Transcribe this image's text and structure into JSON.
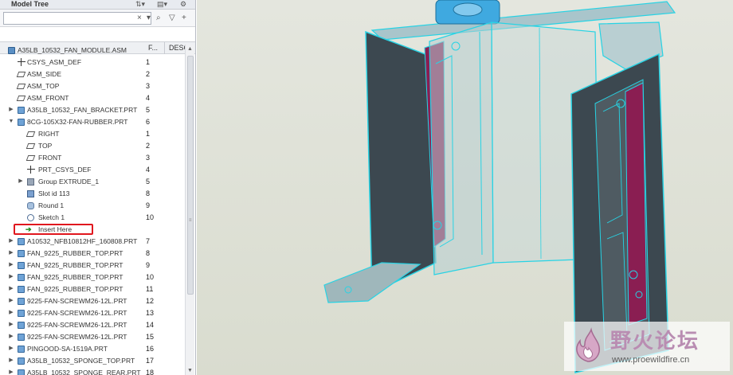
{
  "tree_panel": {
    "title": "Model Tree",
    "search": {
      "value": "",
      "placeholder": ""
    },
    "columns": [
      "F...",
      "DESCF"
    ],
    "rows": [
      {
        "label": "A35LB_10532_FAN_MODULE.ASM",
        "num": "",
        "icon": "assembly-icon",
        "level": 0,
        "expander": ""
      },
      {
        "label": "CSYS_ASM_DEF",
        "num": "1",
        "icon": "csys-icon",
        "level": 1,
        "expander": ""
      },
      {
        "label": "ASM_SIDE",
        "num": "2",
        "icon": "datum-plane-icon",
        "level": 1,
        "expander": ""
      },
      {
        "label": "ASM_TOP",
        "num": "3",
        "icon": "datum-plane-icon",
        "level": 1,
        "expander": ""
      },
      {
        "label": "ASM_FRONT",
        "num": "4",
        "icon": "datum-plane-icon",
        "level": 1,
        "expander": ""
      },
      {
        "label": "A35LB_10532_FAN_BRACKET.PRT",
        "num": "5",
        "icon": "part-icon",
        "level": 1,
        "expander": "▶"
      },
      {
        "label": "8CG-105X32-FAN-RUBBER.PRT",
        "num": "6",
        "icon": "part-icon",
        "level": 1,
        "expander": "▼"
      },
      {
        "label": "RIGHT",
        "num": "1",
        "icon": "datum-plane-icon",
        "level": 2,
        "expander": ""
      },
      {
        "label": "TOP",
        "num": "2",
        "icon": "datum-plane-icon",
        "level": 2,
        "expander": ""
      },
      {
        "label": "FRONT",
        "num": "3",
        "icon": "datum-plane-icon",
        "level": 2,
        "expander": ""
      },
      {
        "label": "PRT_CSYS_DEF",
        "num": "4",
        "icon": "csys-icon",
        "level": 2,
        "expander": ""
      },
      {
        "label": "Group EXTRUDE_1",
        "num": "5",
        "icon": "group-icon",
        "level": 2,
        "expander": "▶"
      },
      {
        "label": "Slot id 113",
        "num": "8",
        "icon": "slot-icon",
        "level": 2,
        "expander": ""
      },
      {
        "label": "Round 1",
        "num": "9",
        "icon": "round-icon",
        "level": 2,
        "expander": ""
      },
      {
        "label": "Sketch 1",
        "num": "10",
        "icon": "sketch-icon",
        "level": 2,
        "expander": ""
      },
      {
        "label": "Insert Here",
        "num": "",
        "icon": "insert-arrow-icon",
        "level": 2,
        "expander": "",
        "highlight": true
      },
      {
        "label": "A10532_NFB10812HF_160808.PRT",
        "num": "7",
        "icon": "part-icon",
        "level": 1,
        "expander": "▶"
      },
      {
        "label": "FAN_9225_RUBBER_TOP.PRT",
        "num": "8",
        "icon": "part-icon",
        "level": 1,
        "expander": "▶"
      },
      {
        "label": "FAN_9225_RUBBER_TOP.PRT",
        "num": "9",
        "icon": "part-icon",
        "level": 1,
        "expander": "▶"
      },
      {
        "label": "FAN_9225_RUBBER_TOP.PRT",
        "num": "10",
        "icon": "part-icon",
        "level": 1,
        "expander": "▶"
      },
      {
        "label": "FAN_9225_RUBBER_TOP.PRT",
        "num": "11",
        "icon": "part-icon",
        "level": 1,
        "expander": "▶"
      },
      {
        "label": "9225-FAN-SCREWM26-12L.PRT",
        "num": "12",
        "icon": "part-icon",
        "level": 1,
        "expander": "▶"
      },
      {
        "label": "9225-FAN-SCREWM26-12L.PRT",
        "num": "13",
        "icon": "part-icon",
        "level": 1,
        "expander": "▶"
      },
      {
        "label": "9225-FAN-SCREWM26-12L.PRT",
        "num": "14",
        "icon": "part-icon",
        "level": 1,
        "expander": "▶"
      },
      {
        "label": "9225-FAN-SCREWM26-12L.PRT",
        "num": "15",
        "icon": "part-icon",
        "level": 1,
        "expander": "▶"
      },
      {
        "label": "PINGOOD-SA-1519A.PRT",
        "num": "16",
        "icon": "part-icon",
        "level": 1,
        "expander": "▶"
      },
      {
        "label": "A35LB_10532_SPONGE_TOP.PRT",
        "num": "17",
        "icon": "part-icon",
        "level": 1,
        "expander": "▶"
      },
      {
        "label": "A35LB_10532_SPONGE_REAR.PRT",
        "num": "18",
        "icon": "part-icon",
        "level": 1,
        "expander": "▶"
      }
    ]
  },
  "watermark": {
    "title": "野火论坛",
    "url": "www.proewildfire.cn"
  },
  "colors": {
    "wireframe": "#27d3e4",
    "shaded_panel": "#3c4850",
    "rubber_strip": "#8a1e52",
    "fan_hub": "#3fa9e0",
    "viewport_bg": "#dfe1d7",
    "insert_highlight": "#e0171e"
  }
}
